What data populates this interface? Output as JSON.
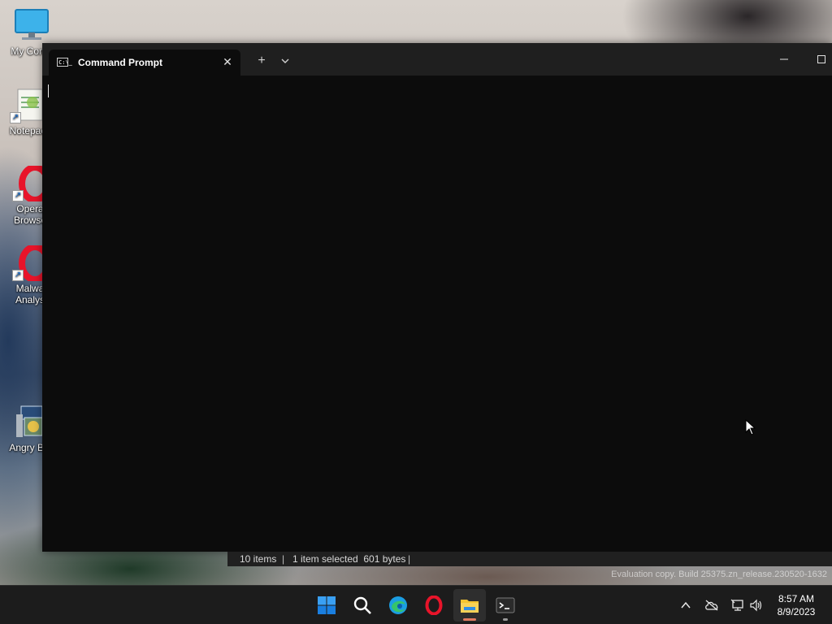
{
  "desktop": {
    "icons": [
      {
        "label": "My Comp",
        "icon": "computer-icon"
      },
      {
        "label": "Notepac",
        "icon": "notepad-icon"
      },
      {
        "label": "Opera\nBrowse",
        "icon": "opera-icon"
      },
      {
        "label": "Malwa\nAnalys",
        "icon": "opera-icon"
      },
      {
        "label": "Angry Bi",
        "icon": "angry-birds-icon"
      }
    ],
    "watermark": "Evaluation copy. Build 25375.zn_release.230520-1632"
  },
  "terminal": {
    "tab_title": "Command Prompt",
    "tab_close_label": "✕",
    "new_tab_label": "+",
    "dropdown_label": "⌄",
    "minimize_label": "—",
    "maximize_label": "☐",
    "tab_icon_text": "C:\\_"
  },
  "explorer_status": {
    "item_count": "10 items",
    "selection": "1 item selected  601 bytes",
    "separator": "|"
  },
  "taskbar": {
    "apps": [
      {
        "name": "start",
        "icon": "windows-logo-icon"
      },
      {
        "name": "search",
        "icon": "search-icon"
      },
      {
        "name": "edge",
        "icon": "edge-icon"
      },
      {
        "name": "opera",
        "icon": "opera-icon"
      },
      {
        "name": "file-explorer",
        "icon": "folder-icon",
        "active": true
      },
      {
        "name": "terminal",
        "icon": "terminal-icon"
      }
    ],
    "tray": {
      "chevron": "^",
      "time": "8:57 AM",
      "date": "8/9/2023"
    }
  },
  "colors": {
    "terminal_bg": "#0c0c0c",
    "titlebar_bg": "#1f1f1f",
    "taskbar_bg": "#1c1c1c",
    "windows_blue": "#0a7cf0",
    "opera_red": "#e8142a",
    "folder_yellow": "#f4c431",
    "active_underline": "#e07a5f"
  }
}
